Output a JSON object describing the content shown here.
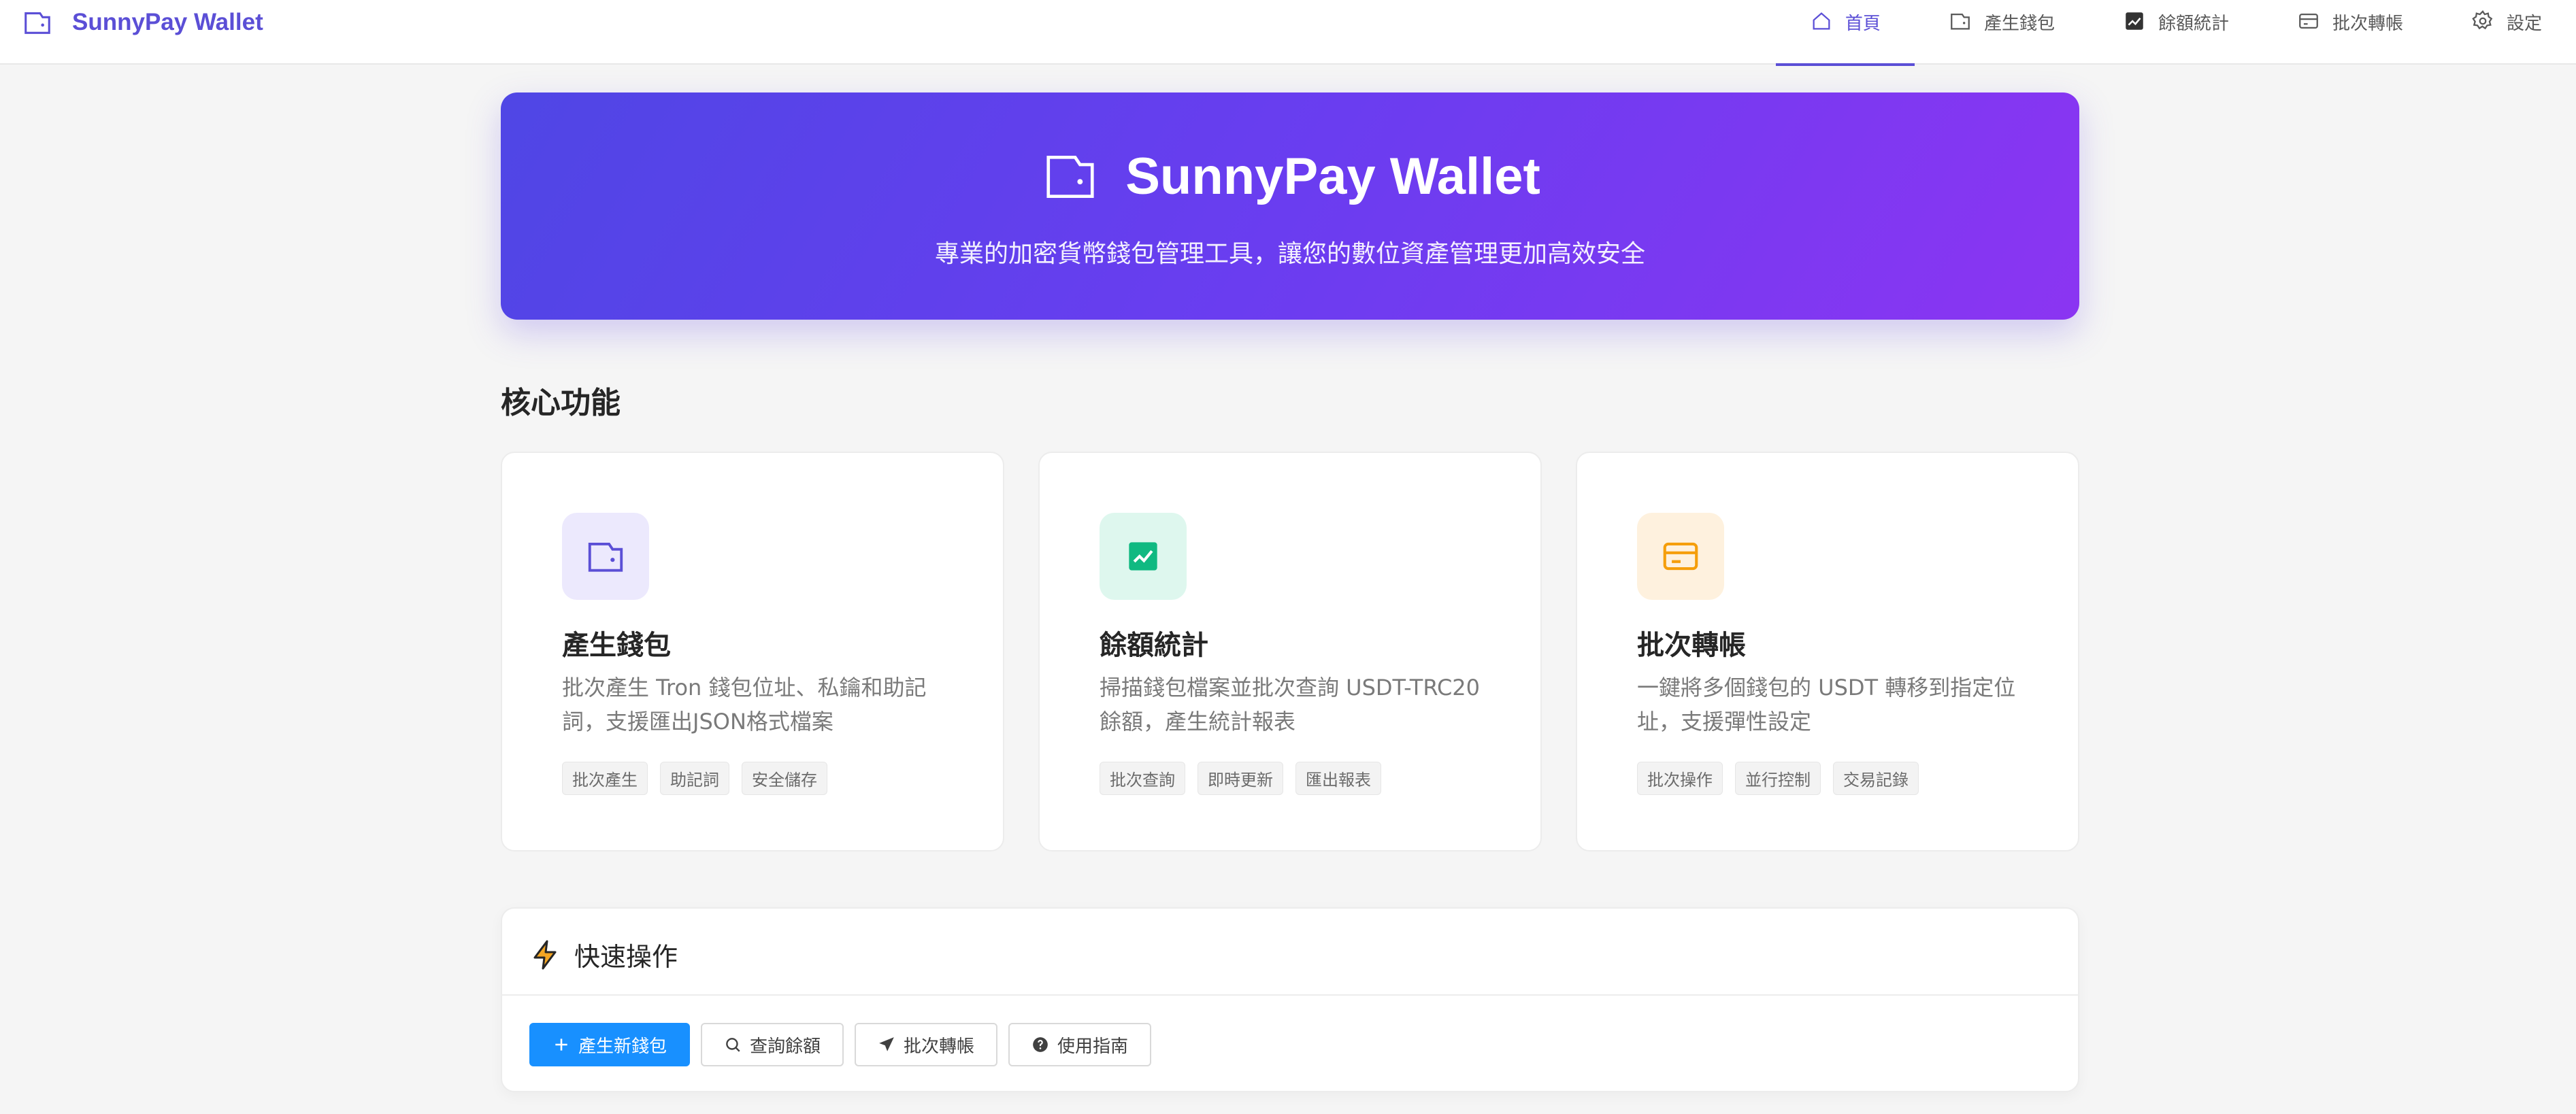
{
  "app": {
    "name": "SunnyPay Wallet"
  },
  "nav": {
    "items": [
      {
        "label": "首頁",
        "icon": "home-icon",
        "active": true
      },
      {
        "label": "產生錢包",
        "icon": "wallet-icon",
        "active": false
      },
      {
        "label": "餘額統計",
        "icon": "chart-icon",
        "active": false
      },
      {
        "label": "批次轉帳",
        "icon": "card-icon",
        "active": false
      },
      {
        "label": "設定",
        "icon": "gear-icon",
        "active": false
      }
    ]
  },
  "hero": {
    "title": "SunnyPay Wallet",
    "subtitle": "專業的加密貨幣錢包管理工具，讓您的數位資產管理更加高效安全",
    "icon": "wallet-icon"
  },
  "features": {
    "title": "核心功能",
    "cards": [
      {
        "title": "產生錢包",
        "description": "批次產生 Tron 錢包位址、私鑰和助記詞，支援匯出JSON格式檔案",
        "tags": [
          "批次產生",
          "助記詞",
          "安全儲存"
        ],
        "icon": "wallet-icon",
        "icon_color": "#5b4fd6",
        "icon_bg": "#ece9fd"
      },
      {
        "title": "餘額統計",
        "description": "掃描錢包檔案並批次查詢 USDT-TRC20 餘額，產生統計報表",
        "tags": [
          "批次查詢",
          "即時更新",
          "匯出報表"
        ],
        "icon": "chart-icon",
        "icon_color": "#10b981",
        "icon_bg": "#def7ee"
      },
      {
        "title": "批次轉帳",
        "description": "一鍵將多個錢包的 USDT 轉移到指定位址，支援彈性設定",
        "tags": [
          "批次操作",
          "並行控制",
          "交易記錄"
        ],
        "icon": "card-icon",
        "icon_color": "#f59e0b",
        "icon_bg": "#fef1de"
      }
    ]
  },
  "quick_actions": {
    "title": "快速操作",
    "icon": "lightning-icon",
    "buttons": [
      {
        "label": "產生新錢包",
        "icon": "plus-icon",
        "primary": true
      },
      {
        "label": "查詢餘額",
        "icon": "search-icon",
        "primary": false
      },
      {
        "label": "批次轉帳",
        "icon": "send-icon",
        "primary": false
      },
      {
        "label": "使用指南",
        "icon": "help-icon",
        "primary": false
      }
    ]
  },
  "colors": {
    "brand": "#5b4fd6",
    "primary_button": "#1890ff",
    "hero_gradient": [
      "#4f46e5",
      "#8b35f2"
    ]
  }
}
